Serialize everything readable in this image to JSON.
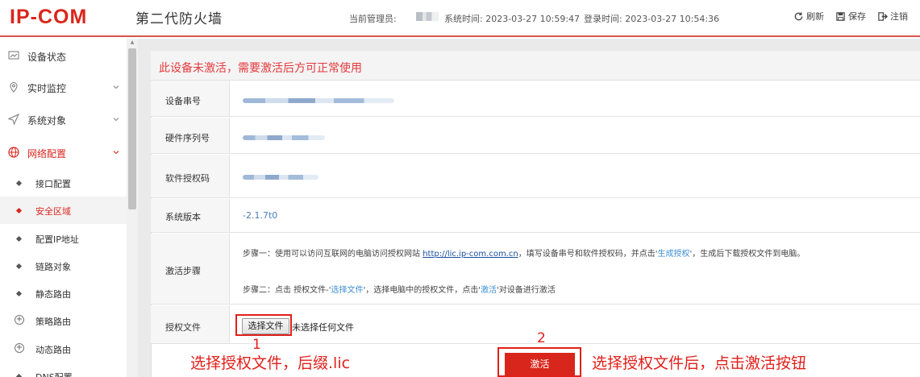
{
  "header": {
    "logo": "IP-COM",
    "product": "第二代防火墙",
    "admin_label": "当前管理员:",
    "system_time": "系统时间: 2023-03-27 10:59:47",
    "login_time": "登录时间: 2023-03-27 10:54:36",
    "refresh_label": "刷新",
    "save_label": "保存",
    "logout_label": "注销"
  },
  "sidebar": {
    "items": [
      {
        "label": "设备状态"
      },
      {
        "label": "实时监控"
      },
      {
        "label": "系统对象"
      },
      {
        "label": "网络配置"
      }
    ],
    "subitems": [
      {
        "label": "接口配置"
      },
      {
        "label": "安全区域"
      },
      {
        "label": "配置IP地址"
      },
      {
        "label": "链路对象"
      },
      {
        "label": "静态路由"
      },
      {
        "label": "策略路由"
      },
      {
        "label": "动态路由"
      },
      {
        "label": "DNS配置"
      }
    ]
  },
  "main": {
    "warning": "此设备未激活，需要激活后方可正常使用",
    "rows": {
      "serial_label": "设备串号",
      "hw_serial_label": "硬件序列号",
      "license_label": "软件授权码",
      "version_label": "系统版本",
      "version_value": "-2.1.7t0",
      "steps_label": "激活步骤",
      "license_file_label": "授权文件"
    },
    "step1": {
      "prefix": "步骤一：使用可以访问互联网的电脑访问授权网站 ",
      "link": "http://lic.ip-com.com.cn",
      "middle": "，填写设备串号和软件授权码，并点击'",
      "action": "生成授权",
      "suffix": "'，生成后下载授权文件到电脑。"
    },
    "step2": {
      "prefix": "步骤二：点击 授权文件-'",
      "action1": "选择文件",
      "middle": "'，选择电脑中的授权文件，点击'",
      "action2": "激活",
      "suffix": "'对设备进行激活"
    },
    "choose_file": "选择文件",
    "no_file": "未选择任何文件",
    "activate": "激活"
  },
  "annotations": {
    "num1": "1",
    "num2": "2",
    "text1": "选择授权文件，后缀.lic",
    "text2": "选择授权文件后，点击激活按钮"
  },
  "colors": {
    "brand_red": "#d9261c",
    "warning_red": "#e4393c",
    "link_blue": "#1a4fa0",
    "annotation_red": "#e0201b"
  }
}
